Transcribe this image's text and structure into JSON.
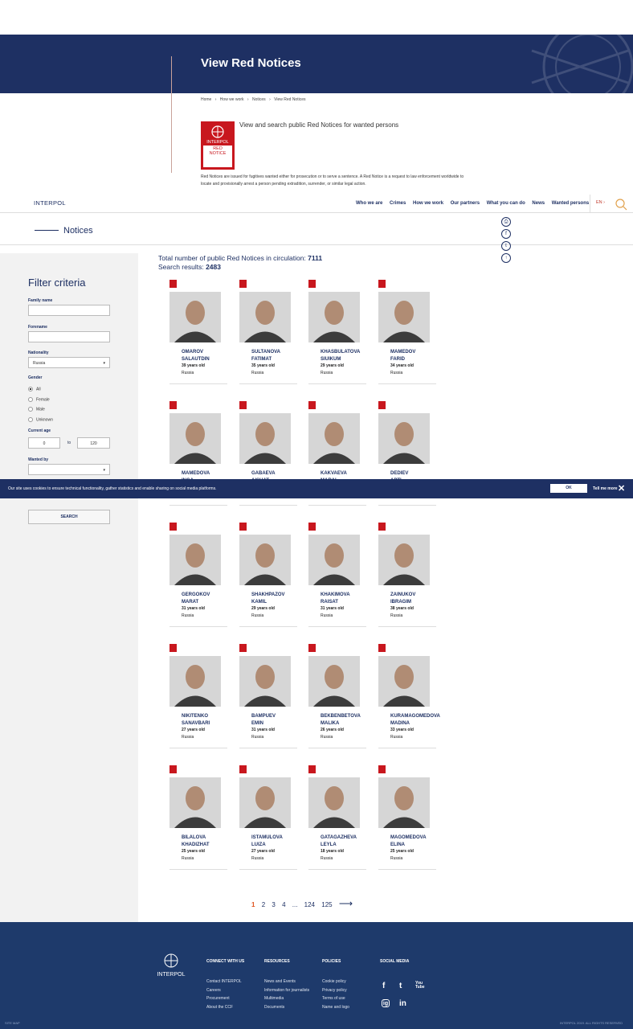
{
  "page": {
    "title": "View Red Notices"
  },
  "breadcrumb": [
    "Home",
    "›",
    "How we work",
    "›",
    "Notices",
    "›",
    "View Red Notices"
  ],
  "intro": {
    "badge_top": "INTERPOL",
    "badge_bottom_1": "RED",
    "badge_bottom_2": "NOTICE",
    "headline": "View and search public Red Notices for wanted persons",
    "description": "Red Notices are issued for fugitives wanted either for prosecution or to serve a sentence. A Red Notice is a request to law enforcement worldwide to locate and provisionally arrest a person pending extradition, surrender, or similar legal action."
  },
  "nav": {
    "logo": "INTERPOL",
    "items": [
      "Who we are",
      "Crimes",
      "How we work",
      "Our partners",
      "What you can do",
      "News",
      "Wanted persons"
    ],
    "lang": "EN ›"
  },
  "notices_band": {
    "title": "Notices"
  },
  "share": [
    "print-icon",
    "facebook-icon",
    "twitter-icon",
    "scroll-top-icon"
  ],
  "filters": {
    "title": "Filter criteria",
    "family_name_label": "Family name",
    "family_name_value": "",
    "forename_label": "Forename",
    "forename_value": "",
    "nationality_label": "Nationality",
    "nationality_value": "Russia",
    "gender_label": "Gender",
    "gender_options": [
      "All",
      "Female",
      "Male",
      "Unknown"
    ],
    "gender_selected": "All",
    "age_label": "Current age",
    "age_min": "0",
    "age_to": "to",
    "age_max": "120",
    "wanted_by_label": "Wanted by",
    "wanted_by_value": "",
    "search_label": "SEARCH"
  },
  "summary": {
    "total_label": "Total number of public Red Notices in circulation:",
    "total_value": "7111",
    "results_label": "Search results:",
    "results_value": "2483"
  },
  "notices": [
    {
      "family": "OMAROV",
      "given": "SALAUTDIN",
      "age": "39 years old",
      "nationality": "Russia"
    },
    {
      "family": "SULTANOVA",
      "given": "FATIMAT",
      "age": "35 years old",
      "nationality": "Russia"
    },
    {
      "family": "KHASBULATOVA",
      "given": "SIUIKUM",
      "age": "29 years old",
      "nationality": "Russia"
    },
    {
      "family": "MAMEDOV",
      "given": "FARID",
      "age": "34 years old",
      "nationality": "Russia"
    },
    {
      "family": "MAMEDOVA",
      "given": "INGA",
      "age": "",
      "nationality": ""
    },
    {
      "family": "GABAEVA",
      "given": "AISHAT",
      "age": "",
      "nationality": ""
    },
    {
      "family": "KAKVAEVA",
      "given": "MARAL",
      "age": "",
      "nationality": ""
    },
    {
      "family": "DEDIEV",
      "given": "APTI",
      "age": "",
      "nationality": ""
    },
    {
      "family": "GERGOKOV",
      "given": "MARAT",
      "age": "31 years old",
      "nationality": "Russia"
    },
    {
      "family": "SHAKHPAZOV",
      "given": "KAMIL",
      "age": "29 years old",
      "nationality": "Russia"
    },
    {
      "family": "KHAKIMOVA",
      "given": "RAISAT",
      "age": "31 years old",
      "nationality": "Russia"
    },
    {
      "family": "ZAINUKOV",
      "given": "IBRAGIM",
      "age": "38 years old",
      "nationality": "Russia"
    },
    {
      "family": "NIKITENKO",
      "given": "SANAVBARI",
      "age": "27 years old",
      "nationality": "Russia"
    },
    {
      "family": "BAMPUEV",
      "given": "EMIN",
      "age": "31 years old",
      "nationality": "Russia"
    },
    {
      "family": "BEKBENBETOVA",
      "given": "MALIKA",
      "age": "26 years old",
      "nationality": "Russia"
    },
    {
      "family": "KURAMAGOMEDOVA",
      "given": "MADINA",
      "age": "33 years old",
      "nationality": "Russia"
    },
    {
      "family": "BILALOVA",
      "given": "KHADIZHAT",
      "age": "25 years old",
      "nationality": "Russia"
    },
    {
      "family": "ISTAMULOVA",
      "given": "LUIZA",
      "age": "27 years old",
      "nationality": "Russia"
    },
    {
      "family": "GATAGAZHEVA",
      "given": "LEYLA",
      "age": "18 years old",
      "nationality": "Russia"
    },
    {
      "family": "MAGOMEDOVA",
      "given": "ELINA",
      "age": "25 years old",
      "nationality": "Russia"
    }
  ],
  "cookie": {
    "text": "Our site uses cookies to ensure technical functionality, gather statistics and enable sharing on social media platforms.",
    "ok": "OK",
    "more": "Tell me more"
  },
  "pagination": {
    "pages": [
      "1",
      "2",
      "3",
      "4",
      "...",
      "124",
      "125"
    ],
    "current": "1"
  },
  "footer": {
    "logo": "INTERPOL",
    "connect": {
      "title": "CONNECT WITH US",
      "links": [
        "Contact INTERPOL",
        "Careers",
        "Procurement",
        "About the CCF"
      ]
    },
    "resources": {
      "title": "RESOURCES",
      "links": [
        "News and Events",
        "Information for journalists",
        "Multimedia",
        "Documents"
      ]
    },
    "policies": {
      "title": "POLICIES",
      "links": [
        "Cookie policy",
        "Privacy policy",
        "Terms of use",
        "Name and logo"
      ]
    },
    "social": {
      "title": "SOCIAL MEDIA",
      "icons": [
        "f",
        "t",
        "You Tube",
        "ig",
        "in"
      ]
    },
    "sitemap": "SITE MAP",
    "copyright": "INTERPOL 2019. ALL RIGHTS RESERVED"
  },
  "colors": {
    "navy": "#1e3063",
    "red": "#c8171e",
    "footer": "#1e3a6b",
    "accent": "#e0541f"
  }
}
